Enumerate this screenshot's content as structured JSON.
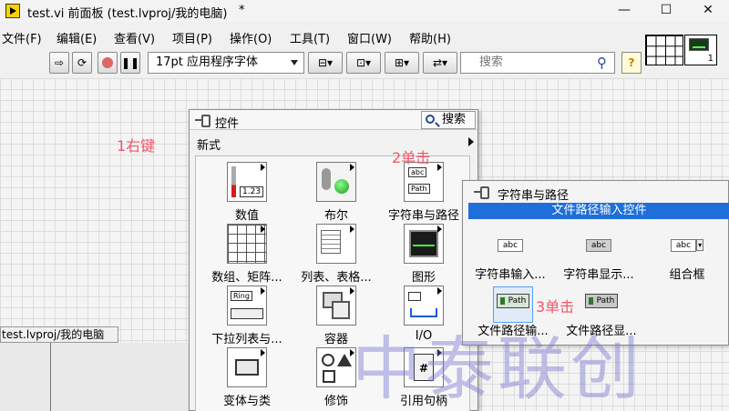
{
  "window": {
    "title": "test.vi 前面板 (test.lvproj/我的电脑)",
    "modified": "*",
    "minimize": "—",
    "maximize": "☐",
    "close": "✕"
  },
  "menu": [
    "文件(F)",
    "编辑(E)",
    "查看(V)",
    "项目(P)",
    "操作(O)",
    "工具(T)",
    "窗口(W)",
    "帮助(H)"
  ],
  "toolbar": {
    "font": "17pt 应用程序字体",
    "search_placeholder": "搜索",
    "help": "?"
  },
  "vi_icon_number": "1",
  "annotations": {
    "right_click": "1右键",
    "click2": "2单击",
    "click3": "3单击"
  },
  "project_bar": "test.lvproj/我的电脑",
  "palette": {
    "title": "控件",
    "search": "搜索",
    "category": "新式",
    "items": [
      {
        "label": "数值",
        "icon": "numeric-icon",
        "icon_text": "1.23"
      },
      {
        "label": "布尔",
        "icon": "boolean-icon",
        "icon_text": ""
      },
      {
        "label": "字符串与路径",
        "icon": "string-path-icon",
        "icon_text": "abc"
      },
      {
        "label": "数组、矩阵...",
        "icon": "array-matrix-icon",
        "icon_text": ""
      },
      {
        "label": "列表、表格...",
        "icon": "list-table-icon",
        "icon_text": ""
      },
      {
        "label": "图形",
        "icon": "graph-icon",
        "icon_text": ""
      },
      {
        "label": "下拉列表与...",
        "icon": "ring-enum-icon",
        "icon_text": "Ring"
      },
      {
        "label": "容器",
        "icon": "containers-icon",
        "icon_text": ""
      },
      {
        "label": "I/O",
        "icon": "io-icon",
        "icon_text": ""
      },
      {
        "label": "变体与类",
        "icon": "variant-class-icon",
        "icon_text": ""
      },
      {
        "label": "修饰",
        "icon": "decorations-icon",
        "icon_text": ""
      },
      {
        "label": "引用句柄",
        "icon": "refnum-icon",
        "icon_text": "#"
      }
    ]
  },
  "submenu": {
    "title": "字符串与路径",
    "tooltip": "文件路径输入控件",
    "items": [
      {
        "label": "字符串输入...",
        "icon_text": "abc"
      },
      {
        "label": "字符串显示...",
        "icon_text": "abc"
      },
      {
        "label": "组合框",
        "icon_text": "abc"
      },
      {
        "label": "文件路径输...",
        "icon_text": "Path"
      },
      {
        "label": "文件路径显...",
        "icon_text": "Path"
      }
    ]
  },
  "watermark": "中泰联创",
  "colors": {
    "annotation": "#f0566a",
    "tooltip_bg": "#1e6fd9",
    "watermark": "#7878d2"
  }
}
